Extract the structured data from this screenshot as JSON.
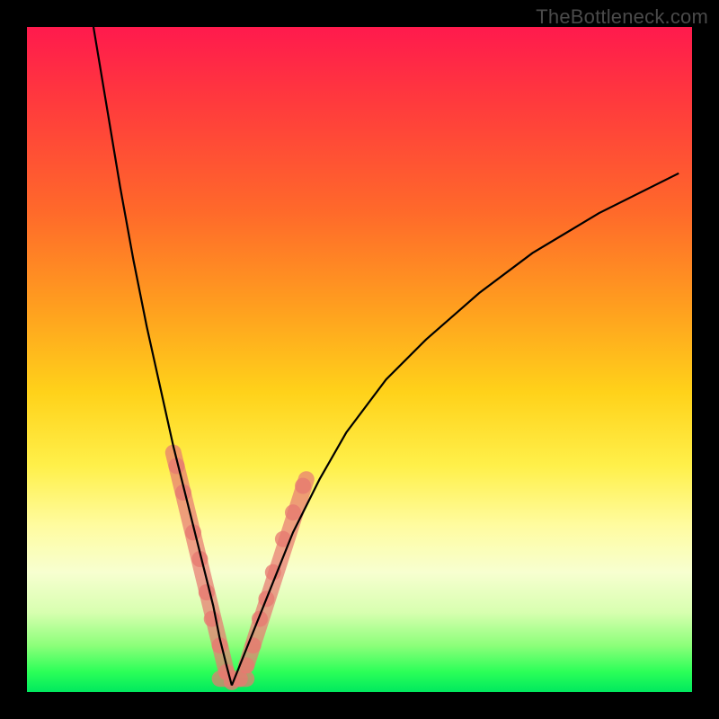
{
  "watermark": "TheBottleneck.com",
  "colors": {
    "frame_bg": "#000000",
    "curve_stroke": "#000000",
    "guide_stroke": "#e77a71",
    "gradient_stops": [
      "#ff1a4d",
      "#ff3c3c",
      "#ff6a2a",
      "#ff9e1f",
      "#ffd21a",
      "#fff04a",
      "#fffca0",
      "#f7ffd0",
      "#d8ffb0",
      "#8cff7a",
      "#2bff58",
      "#00e85e"
    ]
  },
  "chart_data": {
    "type": "line",
    "title": "",
    "xlabel": "",
    "ylabel": "",
    "xlim": [
      0,
      100
    ],
    "ylim": [
      0,
      100
    ],
    "series": [
      {
        "name": "left-branch",
        "x": [
          10,
          12,
          14,
          16,
          18,
          20,
          22,
          24,
          26,
          28,
          29,
          30,
          30.8
        ],
        "y": [
          100,
          88,
          76,
          65,
          55,
          46,
          37,
          29,
          21,
          13,
          8,
          4,
          1
        ]
      },
      {
        "name": "right-branch",
        "x": [
          30.8,
          32,
          34,
          36,
          38,
          40,
          44,
          48,
          54,
          60,
          68,
          76,
          86,
          98
        ],
        "y": [
          1,
          4,
          9,
          14,
          19,
          24,
          32,
          39,
          47,
          53,
          60,
          66,
          72,
          78
        ]
      }
    ],
    "highlight_dots": [
      {
        "x": 22.5,
        "y": 34
      },
      {
        "x": 23.5,
        "y": 30
      },
      {
        "x": 25.0,
        "y": 24
      },
      {
        "x": 26.0,
        "y": 20
      },
      {
        "x": 27.0,
        "y": 15
      },
      {
        "x": 27.8,
        "y": 11
      },
      {
        "x": 29.0,
        "y": 7
      },
      {
        "x": 30.0,
        "y": 3
      },
      {
        "x": 30.8,
        "y": 1.5
      },
      {
        "x": 32.0,
        "y": 2
      },
      {
        "x": 33.0,
        "y": 4
      },
      {
        "x": 34.0,
        "y": 7
      },
      {
        "x": 35.0,
        "y": 11
      },
      {
        "x": 36.0,
        "y": 14
      },
      {
        "x": 37.0,
        "y": 18
      },
      {
        "x": 38.5,
        "y": 23
      },
      {
        "x": 40.0,
        "y": 27
      },
      {
        "x": 41.5,
        "y": 31
      }
    ],
    "guides": [
      {
        "name": "left-highlight",
        "from": {
          "x": 22,
          "y": 36
        },
        "to": {
          "x": 30,
          "y": 3
        }
      },
      {
        "name": "bottom-highlight",
        "from": {
          "x": 29,
          "y": 2
        },
        "to": {
          "x": 33,
          "y": 2
        }
      },
      {
        "name": "right-highlight",
        "from": {
          "x": 33,
          "y": 4
        },
        "to": {
          "x": 42,
          "y": 32
        }
      }
    ]
  }
}
